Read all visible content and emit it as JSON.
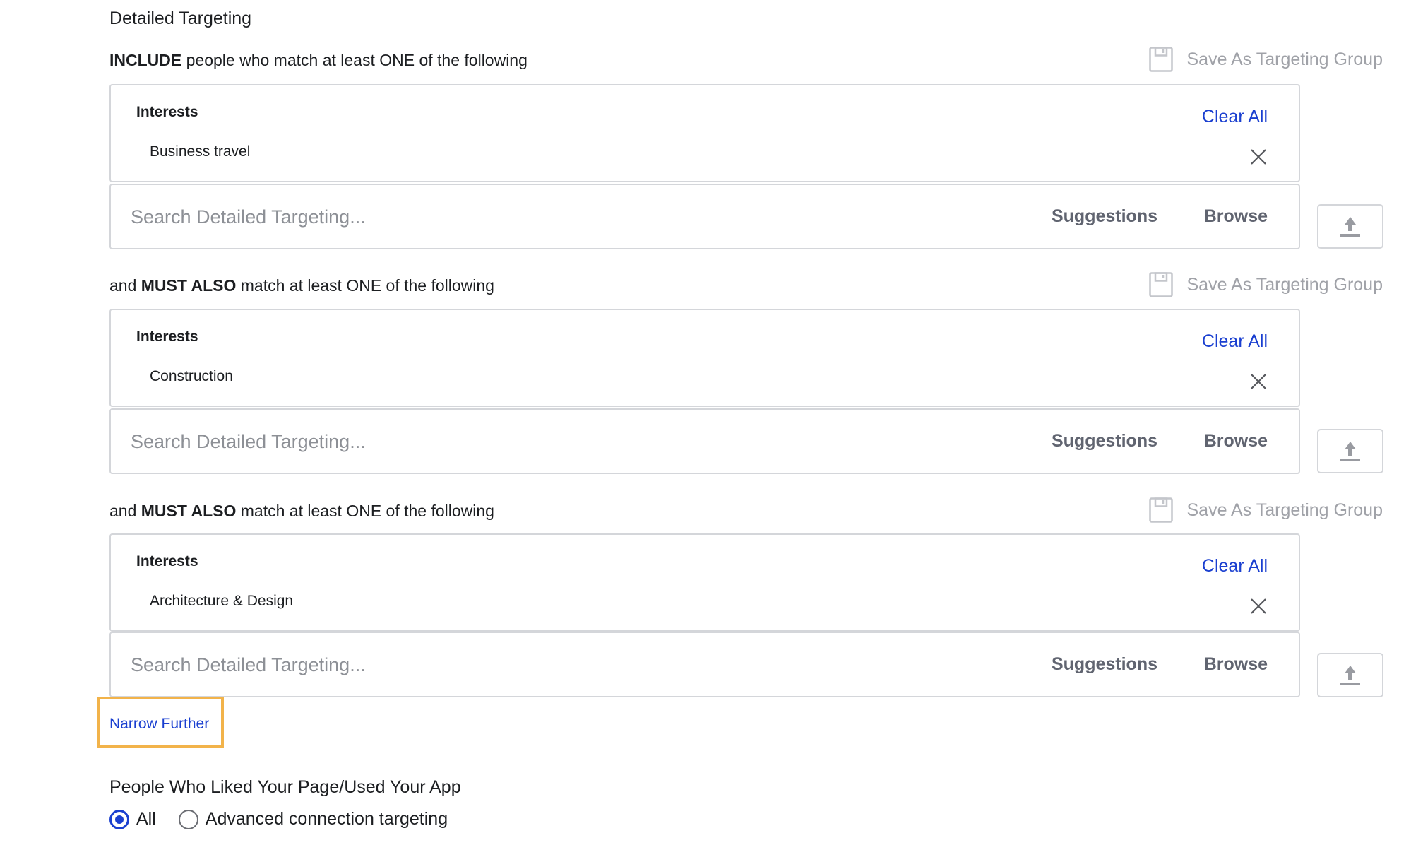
{
  "title": "Detailed Targeting",
  "sections": [
    {
      "header_prefix": "",
      "header_bold": "INCLUDE",
      "header_suffix": " people who match at least ONE of the following",
      "save_group_label": "Save As Targeting Group",
      "category": "Interests",
      "items": [
        "Business travel"
      ],
      "clear_all_label": "Clear All",
      "search_placeholder": "Search Detailed Targeting...",
      "search_value": "",
      "suggestions_label": "Suggestions",
      "browse_label": "Browse"
    },
    {
      "header_prefix": "and ",
      "header_bold": "MUST ALSO",
      "header_suffix": " match at least ONE of the following",
      "save_group_label": "Save As Targeting Group",
      "category": "Interests",
      "items": [
        "Construction"
      ],
      "clear_all_label": "Clear All",
      "search_placeholder": "Search Detailed Targeting...",
      "search_value": "",
      "suggestions_label": "Suggestions",
      "browse_label": "Browse"
    },
    {
      "header_prefix": "and ",
      "header_bold": "MUST ALSO",
      "header_suffix": " match at least ONE of the following",
      "save_group_label": "Save As Targeting Group",
      "category": "Interests",
      "items": [
        "Architecture & Design"
      ],
      "clear_all_label": "Clear All",
      "search_placeholder": "Search Detailed Targeting...",
      "search_value": "",
      "suggestions_label": "Suggestions",
      "browse_label": "Browse"
    }
  ],
  "narrow_further_label": "Narrow Further",
  "connections": {
    "heading": "People Who Liked Your Page/Used Your App",
    "options": [
      {
        "label": "All",
        "selected": true
      },
      {
        "label": "Advanced connection targeting",
        "selected": false
      }
    ]
  },
  "icons": {
    "save_group": "floppy-disk-icon",
    "remove": "close-x-icon",
    "upload": "upload-arrow-icon"
  },
  "colors": {
    "link": "#1a3fd0",
    "highlight": "#f2b34a",
    "muted": "#a0a2a8",
    "border": "#d4d6da"
  }
}
